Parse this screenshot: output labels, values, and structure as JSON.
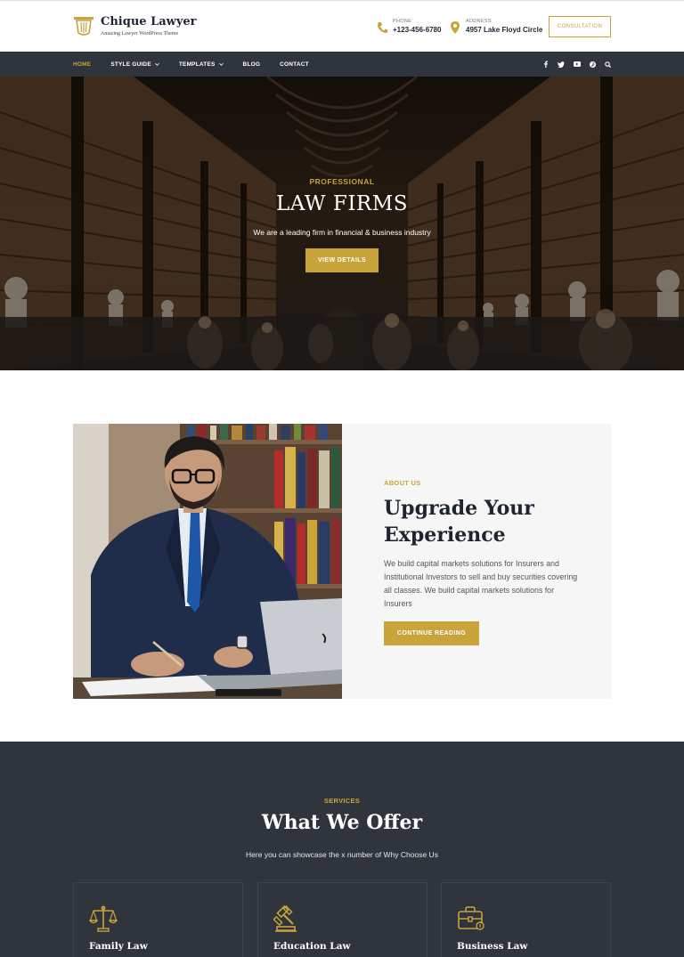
{
  "brand": {
    "name": "Chique Lawyer",
    "tagline": "Amazing Lawyer WordPress Theme"
  },
  "contacts": {
    "phone": {
      "label": "PHONE",
      "value": "+123-456-6780",
      "icon": "phone-icon"
    },
    "address": {
      "label": "ADDRESS",
      "value": "4957 Lake Floyd Circle",
      "icon": "map-pin-icon"
    }
  },
  "header": {
    "cta_label": "CONSULTATION"
  },
  "nav": {
    "items": [
      {
        "label": "HOME",
        "active": true,
        "dropdown": false
      },
      {
        "label": "STYLE GUIDE",
        "active": false,
        "dropdown": true
      },
      {
        "label": "TEMPLATES",
        "active": false,
        "dropdown": true
      },
      {
        "label": "BLOG",
        "active": false,
        "dropdown": false
      },
      {
        "label": "CONTACT",
        "active": false,
        "dropdown": false
      }
    ],
    "social_icons": [
      "facebook-icon",
      "twitter-icon",
      "youtube-icon",
      "pinterest-icon",
      "search-icon"
    ]
  },
  "hero": {
    "kicker": "PROFESSIONAL",
    "title": "LAW FIRMS",
    "subtitle": "We are a leading firm in financial & business industry",
    "button_label": "VIEW DETAILS"
  },
  "about": {
    "kicker": "ABOUT US",
    "title": "Upgrade Your Experience",
    "text": "We build capital markets solutions for Insurers and Institutional Investors to sell and buy securities covering all classes. We build capital markets solutions for Insurers",
    "button_label": "CONTINUE READING"
  },
  "services": {
    "kicker": "SERVICES",
    "title": "What We Offer",
    "subtitle": "Here you can showcase the x number of Why Choose Us",
    "cards": [
      {
        "name": "Family Law",
        "icon": "scales-icon"
      },
      {
        "name": "Education Law",
        "icon": "gavel-icon"
      },
      {
        "name": "Business Law",
        "icon": "briefcase-icon"
      }
    ]
  },
  "colors": {
    "accent": "#c9a43b",
    "dark": "#2f343d",
    "panel": "#f6f6f6"
  }
}
